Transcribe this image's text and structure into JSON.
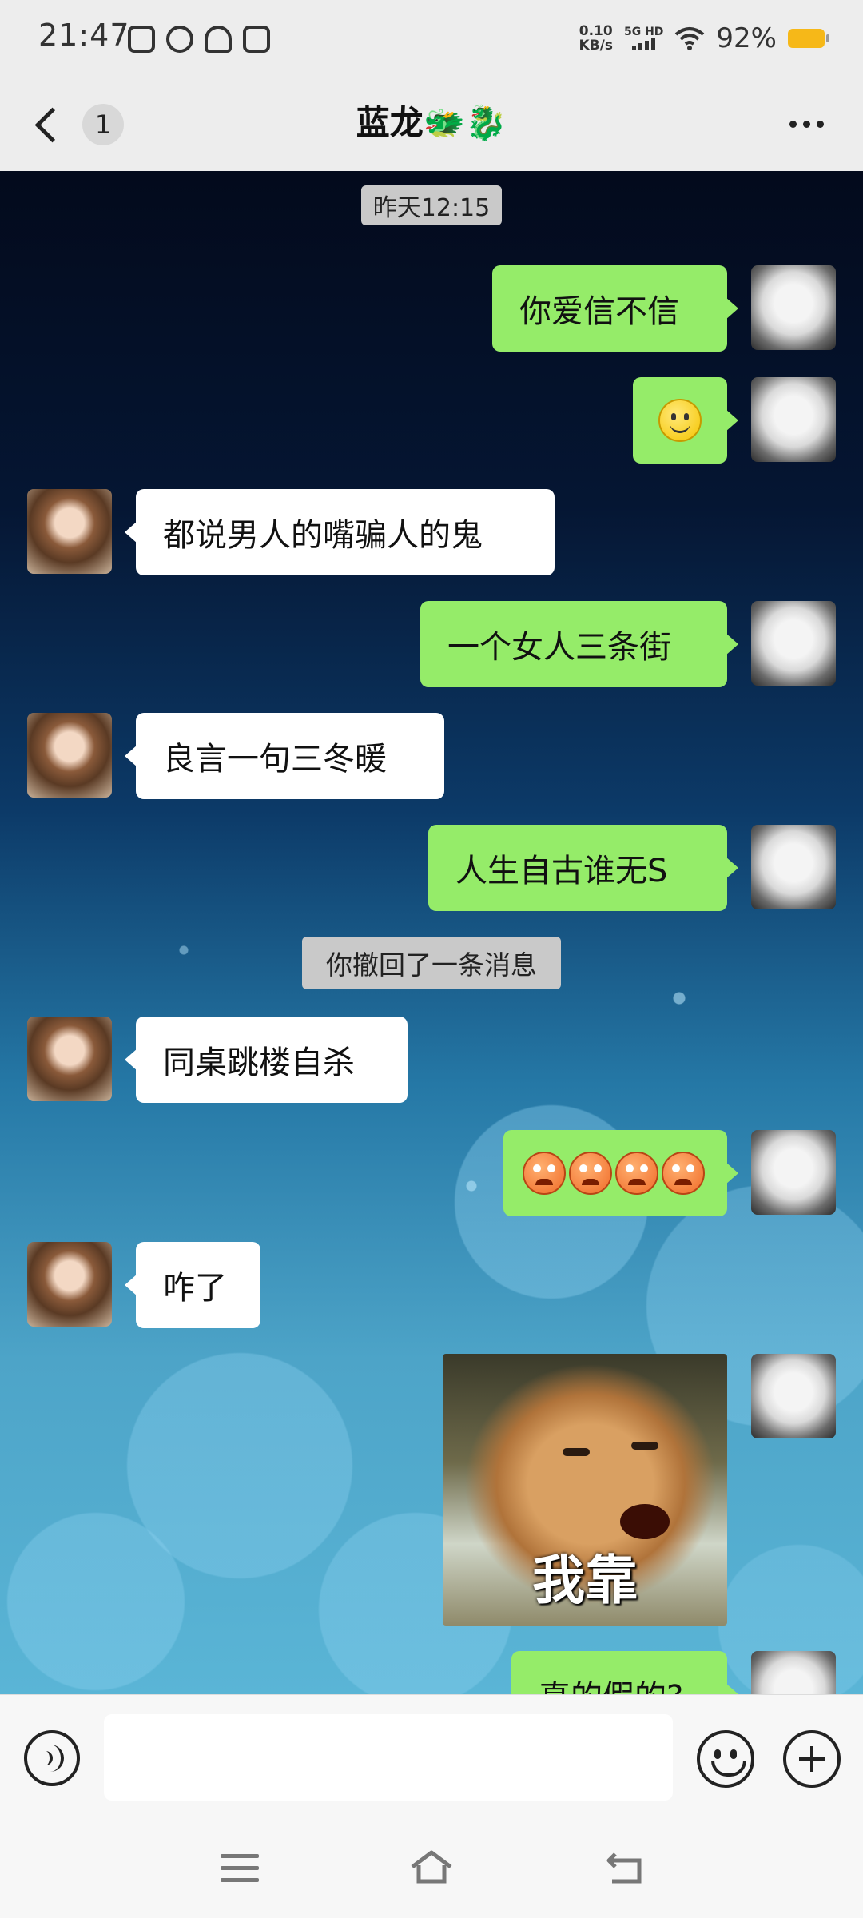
{
  "status_bar": {
    "time": "21:47",
    "speed_top": "0.10",
    "speed_bottom": "KB/s",
    "net": "5G HD",
    "battery": "92%"
  },
  "header": {
    "unread_count": "1",
    "title": "蓝龙🐲🐉"
  },
  "chat": {
    "timestamp": "昨天12:15",
    "recall_notice": "你撤回了一条消息",
    "messages": [
      {
        "from": "me",
        "text": "你爱信不信"
      },
      {
        "from": "me",
        "emoji": "smile"
      },
      {
        "from": "her",
        "text": "都说男人的嘴骗人的鬼"
      },
      {
        "from": "me",
        "text": "一个女人三条街"
      },
      {
        "from": "her",
        "text": "良言一句三冬暖"
      },
      {
        "from": "me",
        "text": "人生自古谁无S"
      },
      {
        "from": "her",
        "text": "同桌跳楼自杀"
      },
      {
        "from": "me",
        "emoji": "angry x4"
      },
      {
        "from": "her",
        "text": "咋了"
      },
      {
        "from": "me",
        "sticker_text": "我靠"
      },
      {
        "from": "me",
        "text": "真的假的?"
      }
    ]
  },
  "input": {
    "placeholder": ""
  },
  "icons": [
    "back-chevron-icon",
    "more-dots-icon",
    "voice-icon",
    "emoji-icon",
    "plus-icon",
    "menu-icon",
    "home-icon",
    "back-nav-icon"
  ],
  "colors": {
    "my_bubble": "#95ec69",
    "her_bubble": "#ffffff",
    "bar_bg": "#ededed",
    "battery": "#f6b818"
  }
}
